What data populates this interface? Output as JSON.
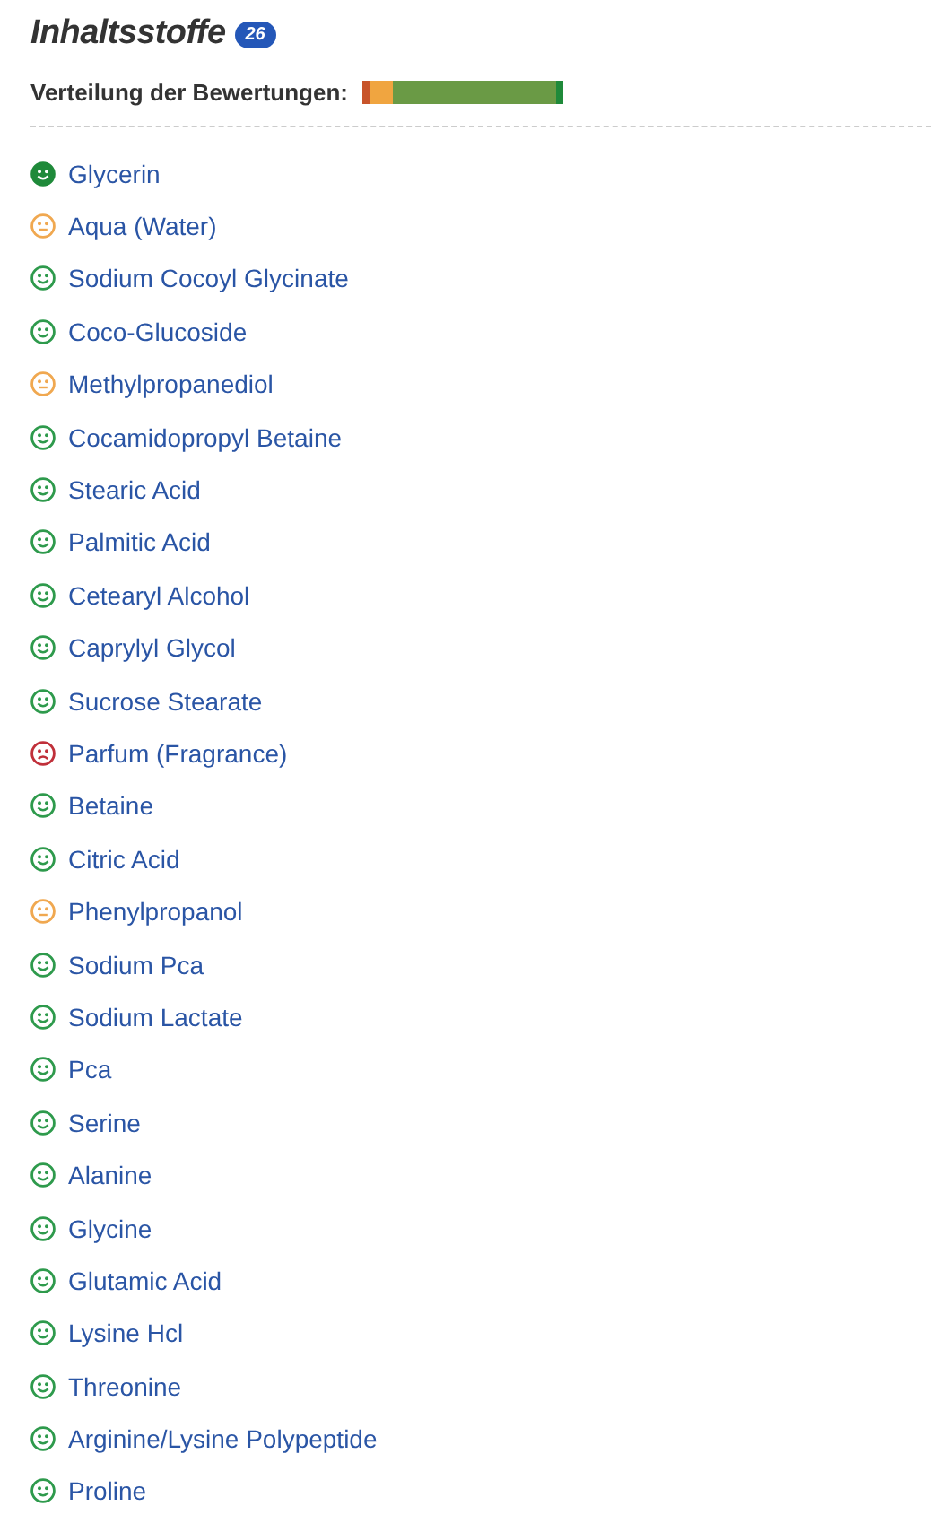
{
  "title": "Inhaltsstoffe",
  "count": "26",
  "distribution": {
    "label": "Verteilung der Bewertungen:"
  },
  "ingredients": [
    {
      "name": "Glycerin",
      "kind": "best"
    },
    {
      "name": "Aqua (Water)",
      "kind": "neutral"
    },
    {
      "name": "Sodium Cocoyl Glycinate",
      "kind": "good"
    },
    {
      "name": "Coco-Glucoside",
      "kind": "good"
    },
    {
      "name": "Methylpropanediol",
      "kind": "neutral"
    },
    {
      "name": "Cocamidopropyl Betaine",
      "kind": "good"
    },
    {
      "name": "Stearic Acid",
      "kind": "good"
    },
    {
      "name": "Palmitic Acid",
      "kind": "good"
    },
    {
      "name": "Cetearyl Alcohol",
      "kind": "good"
    },
    {
      "name": "Caprylyl Glycol",
      "kind": "good"
    },
    {
      "name": "Sucrose Stearate",
      "kind": "good"
    },
    {
      "name": "Parfum (Fragrance)",
      "kind": "bad"
    },
    {
      "name": "Betaine",
      "kind": "good"
    },
    {
      "name": "Citric Acid",
      "kind": "good"
    },
    {
      "name": "Phenylpropanol",
      "kind": "neutral"
    },
    {
      "name": "Sodium Pca",
      "kind": "good"
    },
    {
      "name": "Sodium Lactate",
      "kind": "good"
    },
    {
      "name": "Pca",
      "kind": "good"
    },
    {
      "name": "Serine",
      "kind": "good"
    },
    {
      "name": "Alanine",
      "kind": "good"
    },
    {
      "name": "Glycine",
      "kind": "good"
    },
    {
      "name": "Glutamic Acid",
      "kind": "good"
    },
    {
      "name": "Lysine Hcl",
      "kind": "good"
    },
    {
      "name": "Threonine",
      "kind": "good"
    },
    {
      "name": "Arginine/Lysine Polypeptide",
      "kind": "good"
    },
    {
      "name": "Proline",
      "kind": "good"
    }
  ]
}
